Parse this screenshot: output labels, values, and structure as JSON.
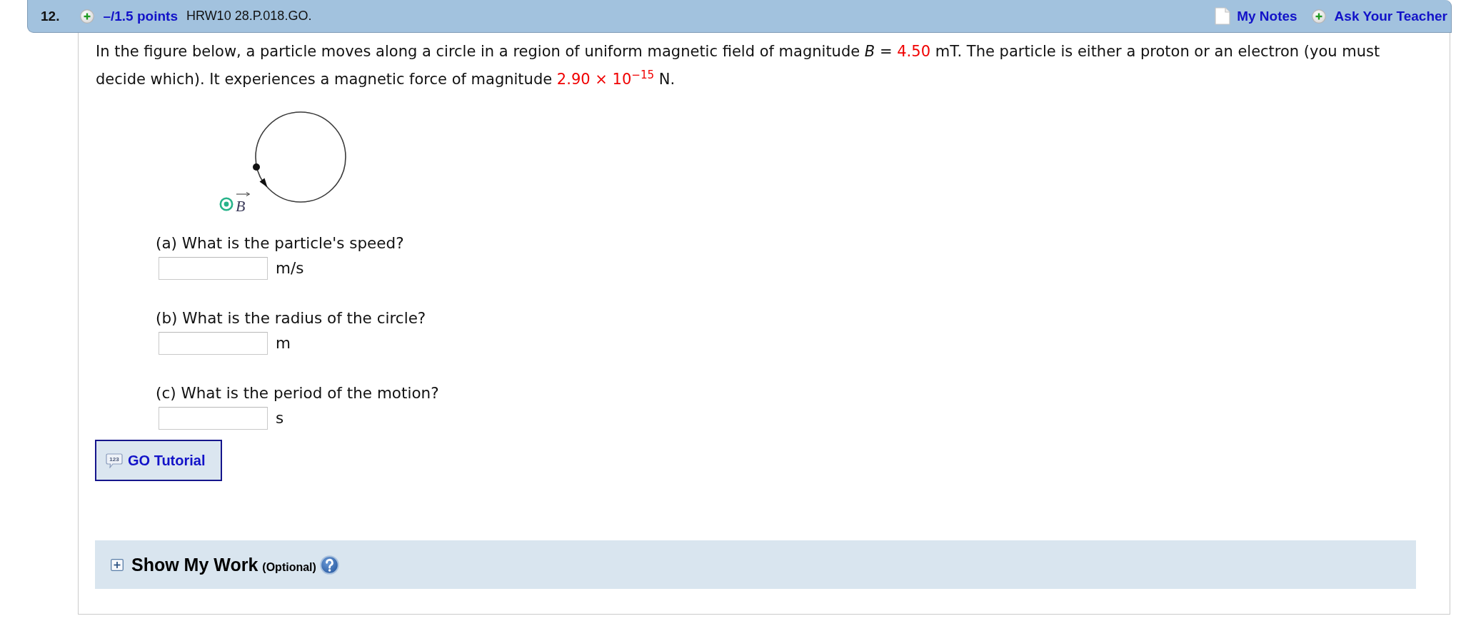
{
  "header": {
    "number": "12.",
    "points": "–/1.5 points",
    "code": "HRW10 28.P.018.GO.",
    "links": [
      {
        "kind": "notes",
        "label": "My Notes"
      },
      {
        "kind": "ask",
        "label": "Ask Your Teacher"
      }
    ]
  },
  "question": {
    "segments": [
      {
        "kind": "text",
        "text": "In the figure below, a particle moves along a circle in a region of uniform magnetic field of magnitude *B* = "
      },
      {
        "kind": "value",
        "text": "4.50"
      },
      {
        "kind": "text",
        "text": " mT. The particle is either a proton or an electron (you must decide which). It experiences a magnetic force of magnitude "
      },
      {
        "kind": "value",
        "text": "2.90 × 10$^{−15}$"
      },
      {
        "kind": "text",
        "text": " N."
      }
    ]
  },
  "figure": {
    "field_label": "B"
  },
  "parts": [
    {
      "prompt": "(a) What is the particle's speed?",
      "unit": "m/s"
    },
    {
      "prompt": "(b) What is the radius of the circle?",
      "unit": "m"
    },
    {
      "prompt": "(c) What is the period of the motion?",
      "unit": "s"
    }
  ],
  "tutorial_button": {
    "label": "GO Tutorial",
    "icon_text": "123"
  },
  "show_my_work": {
    "title": "Show My Work",
    "note": "(Optional)",
    "expanded": false
  }
}
